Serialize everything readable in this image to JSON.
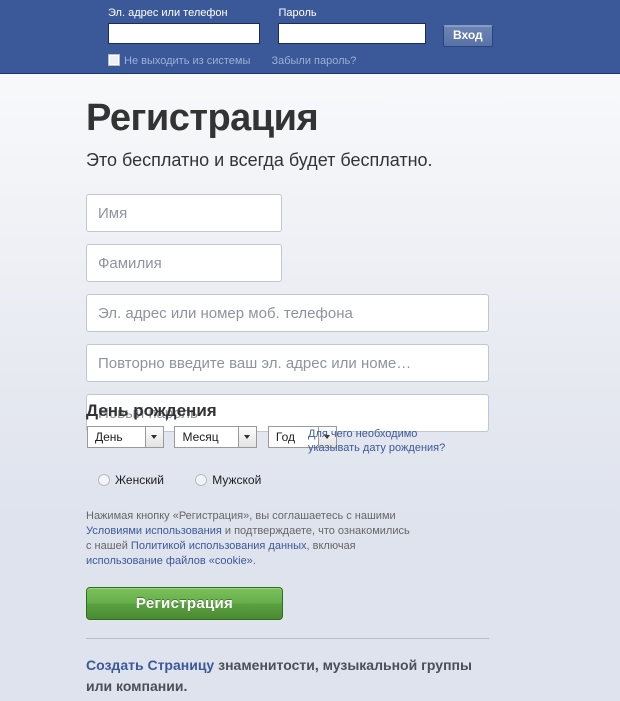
{
  "topbar": {
    "email_label": "Эл. адрес или телефон",
    "email_value": "",
    "password_label": "Пароль",
    "password_value": "",
    "login_button": "Вход",
    "keep_logged_in": "Не выходить из системы",
    "forgot_password": "Забыли пароль?",
    "bg_color": "#3b5998"
  },
  "registration": {
    "title": "Регистрация",
    "subtitle": "Это бесплатно и всегда будет бесплатно.",
    "fields": {
      "first_name_placeholder": "Имя",
      "first_name_value": "",
      "last_name_placeholder": "Фамилия",
      "last_name_value": "",
      "email_placeholder": "Эл. адрес или номер моб. телефона",
      "email_value": "",
      "email_confirm_placeholder": "Повторно введите ваш эл. адрес или номе…",
      "email_confirm_value": "",
      "password_placeholder": "Новый пароль",
      "password_value": ""
    },
    "birthday": {
      "heading": "День рождения",
      "day_selected": "День",
      "month_selected": "Месяц",
      "year_selected": "Год",
      "help_line1": "Для чего необходимо",
      "help_line2": "указывать дату рождения?"
    },
    "gender": {
      "female": "Женский",
      "male": "Мужской"
    },
    "terms": {
      "part1": "Нажимая кнопку «Регистрация», вы соглашаетесь с нашими ",
      "link1": "Условиями использования",
      "part2": " и подтверждаете, что ознакомились с нашей ",
      "link2": "Политикой использования данных",
      "part3": ", включая ",
      "link3": "использование файлов «cookie»",
      "part4": "."
    },
    "submit_button": "Регистрация",
    "submit_color": "#67ae4c"
  },
  "footer": {
    "link": "Создать Страницу",
    "text": " знаменитости, музыкальной группы или компании."
  }
}
